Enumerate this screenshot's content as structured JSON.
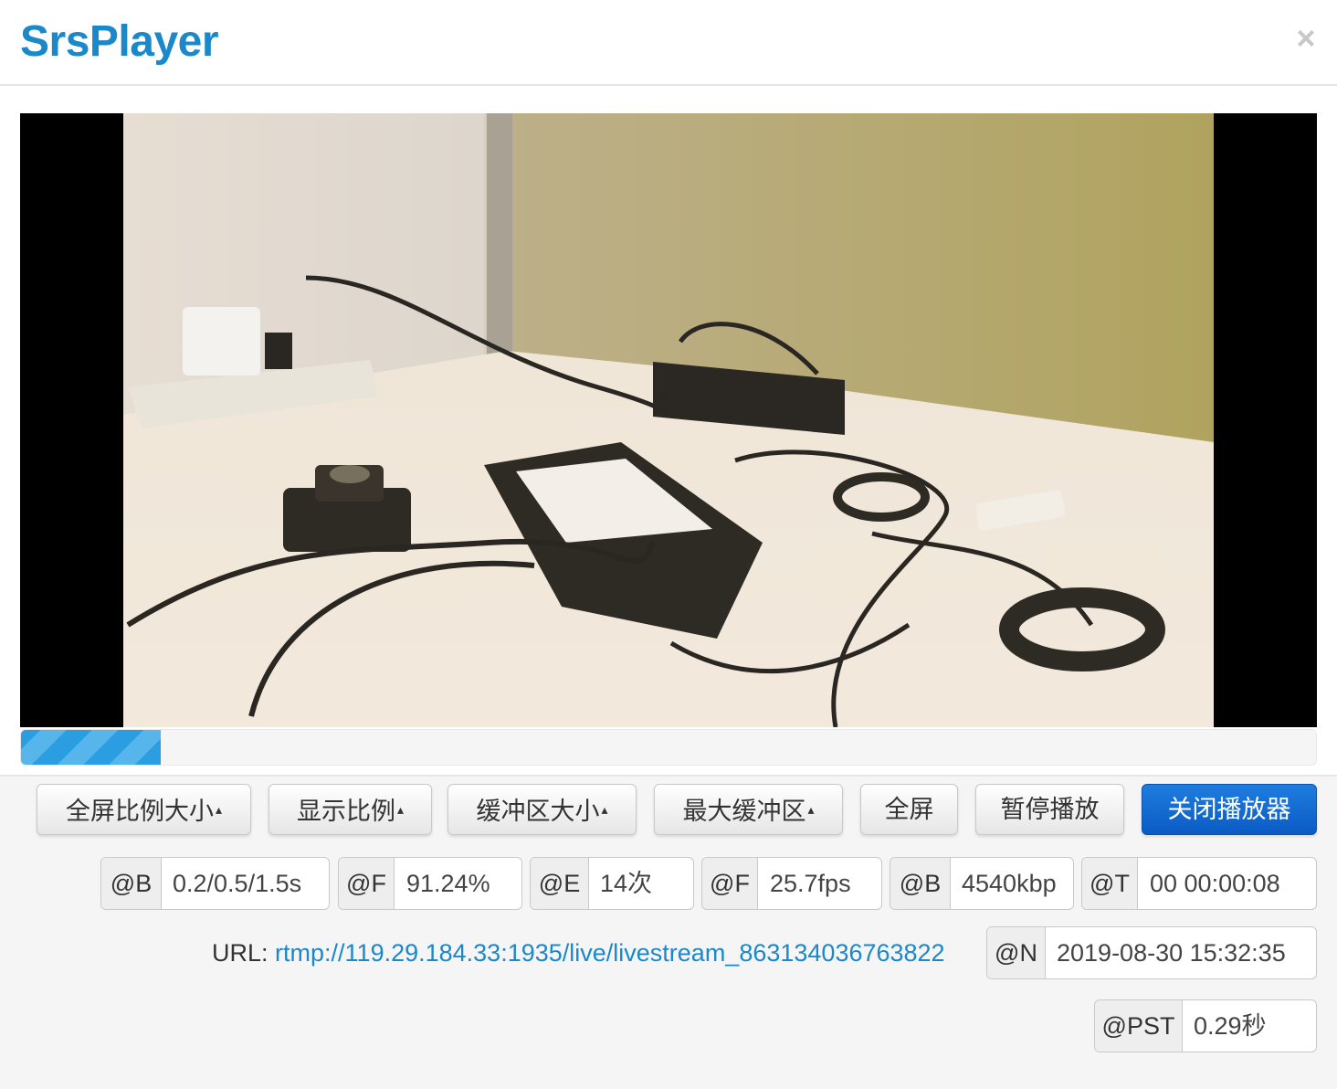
{
  "header": {
    "title": "SrsPlayer",
    "close_label": "×"
  },
  "video": {
    "content": "stream frame of electronic devices and cables on a desk"
  },
  "progress": {
    "fraction": 0.108
  },
  "buttons": [
    {
      "label": "全屏比例大小",
      "caret": "▴"
    },
    {
      "label": "显示比例",
      "caret": "▴"
    },
    {
      "label": "缓冲区大小",
      "caret": "▴"
    },
    {
      "label": "最大缓冲区",
      "caret": "▴"
    },
    {
      "label": "全屏"
    },
    {
      "label": "暂停播放"
    },
    {
      "label": "关闭播放器"
    }
  ],
  "stats": [
    {
      "tag": "@B",
      "value": "0.2/0.5/1.5s"
    },
    {
      "tag": "@F",
      "value": "91.24%"
    },
    {
      "tag": "@E",
      "value": "14次"
    },
    {
      "tag": "@F",
      "value": "25.7fps"
    },
    {
      "tag": "@B",
      "value": "4540kbp"
    },
    {
      "tag": "@T",
      "value": "00 00:00:08"
    }
  ],
  "url": {
    "label": "URL:",
    "value": "rtmp://119.29.184.33:1935/live/livestream_863134036763822"
  },
  "now": {
    "tag": "@N",
    "value": "2019-08-30 15:32:35"
  },
  "pst": {
    "tag": "@PST",
    "value": "0.29秒"
  },
  "colors": {
    "brand": "#1a88c9",
    "primary_button": "#0a5bc4",
    "progress": "#2a9ee0"
  }
}
